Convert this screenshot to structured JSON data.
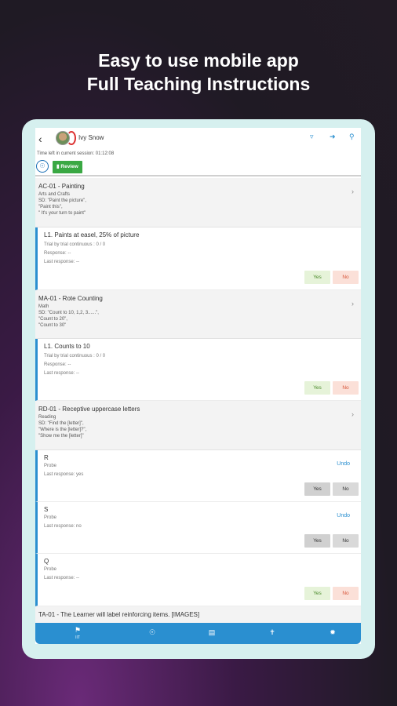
{
  "promo": {
    "line1": "Easy to use mobile app",
    "line2": "Full Teaching Instructions"
  },
  "header": {
    "learner_name": "Ivy Snow",
    "time_left": "Time left in current session: 01:12:08",
    "review_label": "Review",
    "icons": [
      "back-icon",
      "filter-icon",
      "share-icon",
      "search-icon"
    ]
  },
  "programs": [
    {
      "title": "AC-01 - Painting",
      "category": "Arts and Crafts",
      "sd": [
        "SD: \"Paint the picture\",",
        "\"Paint this\",",
        "\" It's your turn to paint\""
      ]
    },
    {
      "title": "MA-01 - Rote Counting",
      "category": "Math",
      "sd": [
        "SD: \"Count to 10, 1,2, 3......\",",
        "\"Count to 20\",",
        "\"Count to 30\""
      ]
    },
    {
      "title": "RD-01 - Receptive uppercase letters",
      "category": "Reading",
      "sd": [
        "SD: \"Find the [letter]\",",
        "\"Where is the [letter]?\",",
        "\"Show me the [letter]\""
      ]
    },
    {
      "title": "TA-01 - The Learner will label reinforcing items. [IMAGES]"
    }
  ],
  "targets": {
    "t1": {
      "title": "L1. Paints at easel, 25% of picture",
      "line1": "Trial by trial continuous : 0 / 0",
      "line2": "Response: --",
      "line3": "Last response: --"
    },
    "t2": {
      "title": "L1. Counts to 10",
      "line1": "Trial by trial continuous : 0 / 0",
      "line2": "Response: --",
      "line3": "Last response: --"
    },
    "t3": {
      "title": "R",
      "line1": "Probe",
      "line2": "Last response: yes"
    },
    "t4": {
      "title": "S",
      "line1": "Probe",
      "line2": "Last response: no"
    },
    "t5": {
      "title": "Q",
      "line1": "Probe",
      "line2": "Last response: --"
    }
  },
  "buttons": {
    "yes": "Yes",
    "no": "No",
    "undo": "Undo"
  },
  "nav": {
    "first_label": "IIT",
    "icons": [
      "flag-icon",
      "globe-icon",
      "list-icon",
      "figure-icon",
      "gear-icon"
    ]
  },
  "colors": {
    "accent": "#2a8fd0",
    "review_green": "#3aa843",
    "tablet_frame": "#d6f0ef"
  }
}
